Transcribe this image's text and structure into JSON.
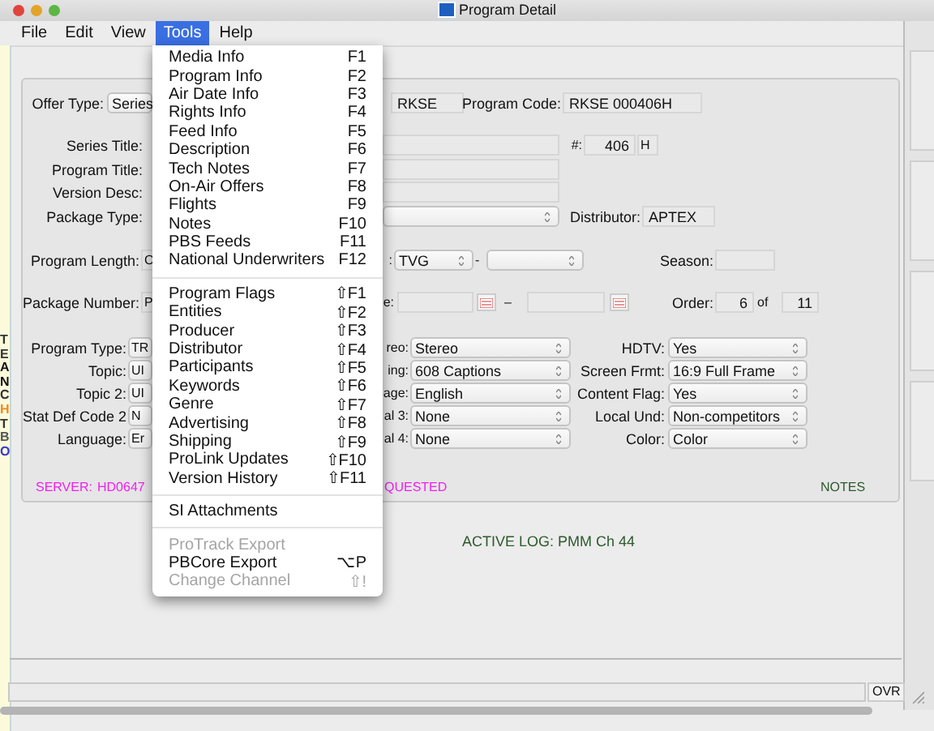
{
  "window": {
    "title": "Program Detail"
  },
  "background_window": {
    "letters": [
      {
        "text": "T",
        "color": "#333333"
      },
      {
        "text": "E",
        "color": "#333333"
      },
      {
        "text": "A",
        "color": "#111111"
      },
      {
        "text": "N",
        "color": "#111111"
      },
      {
        "text": "C",
        "color": "#333333"
      },
      {
        "text": "H",
        "color": "#f08a1c"
      },
      {
        "text": "T",
        "color": "#333333"
      },
      {
        "text": "B",
        "color": "#555555"
      },
      {
        "text": "O",
        "color": "#3a3ad0"
      }
    ]
  },
  "menubar": [
    {
      "label": "File",
      "selected": false
    },
    {
      "label": "Edit",
      "selected": false
    },
    {
      "label": "View",
      "selected": false
    },
    {
      "label": "Tools",
      "selected": true
    },
    {
      "label": "Help",
      "selected": false
    }
  ],
  "tools_menu": {
    "items": [
      {
        "kind": "item",
        "label": "Media Info",
        "shortcut": "F1",
        "disabled": false
      },
      {
        "kind": "item",
        "label": "Program Info",
        "shortcut": "F2",
        "disabled": false
      },
      {
        "kind": "item",
        "label": "Air Date Info",
        "shortcut": "F3",
        "disabled": false
      },
      {
        "kind": "item",
        "label": "Rights Info",
        "shortcut": "F4",
        "disabled": false
      },
      {
        "kind": "item",
        "label": "Feed Info",
        "shortcut": "F5",
        "disabled": false
      },
      {
        "kind": "item",
        "label": "Description",
        "shortcut": "F6",
        "disabled": false
      },
      {
        "kind": "item",
        "label": "Tech Notes",
        "shortcut": "F7",
        "disabled": false
      },
      {
        "kind": "item",
        "label": "On-Air Offers",
        "shortcut": "F8",
        "disabled": false
      },
      {
        "kind": "item",
        "label": "Flights",
        "shortcut": "F9",
        "disabled": false
      },
      {
        "kind": "item",
        "label": "Notes",
        "shortcut": "F10",
        "disabled": false
      },
      {
        "kind": "item",
        "label": "PBS Feeds",
        "shortcut": "F11",
        "disabled": false
      },
      {
        "kind": "item",
        "label": "National Underwriters",
        "shortcut": "F12",
        "disabled": false
      },
      {
        "kind": "separator"
      },
      {
        "kind": "item",
        "label": "Program Flags",
        "shortcut": "⇧F1",
        "disabled": false
      },
      {
        "kind": "item",
        "label": "Entities",
        "shortcut": "⇧F2",
        "disabled": false
      },
      {
        "kind": "item",
        "label": "Producer",
        "shortcut": "⇧F3",
        "disabled": false
      },
      {
        "kind": "item",
        "label": "Distributor",
        "shortcut": "⇧F4",
        "disabled": false
      },
      {
        "kind": "item",
        "label": "Participants",
        "shortcut": "⇧F5",
        "disabled": false
      },
      {
        "kind": "item",
        "label": "Keywords",
        "shortcut": "⇧F6",
        "disabled": false
      },
      {
        "kind": "item",
        "label": "Genre",
        "shortcut": "⇧F7",
        "disabled": false
      },
      {
        "kind": "item",
        "label": "Advertising",
        "shortcut": "⇧F8",
        "disabled": false
      },
      {
        "kind": "item",
        "label": "Shipping",
        "shortcut": "⇧F9",
        "disabled": false
      },
      {
        "kind": "item",
        "label": "ProLink Updates",
        "shortcut": "⇧F10",
        "disabled": false
      },
      {
        "kind": "item",
        "label": "Version History",
        "shortcut": "⇧F11",
        "disabled": false
      },
      {
        "kind": "separator"
      },
      {
        "kind": "item",
        "label": "SI Attachments",
        "disabled": false
      },
      {
        "kind": "separator"
      },
      {
        "kind": "item",
        "label": "ProTrack Export",
        "disabled": true
      },
      {
        "kind": "item",
        "label": "PBCore Export",
        "shortcut": "⌥P",
        "disabled": false
      },
      {
        "kind": "item",
        "label": "Change Channel",
        "shortcut": "⇧!",
        "disabled": true
      }
    ]
  },
  "form": {
    "rows": [
      {
        "items": [
          {
            "kind": "label",
            "text": "Offer Type:"
          },
          {
            "kind": "select",
            "value": "Series"
          },
          {
            "kind": "field",
            "value": "RKSE"
          },
          {
            "kind": "label",
            "text": "Program Code:"
          },
          {
            "kind": "field",
            "value": "RKSE  000406H"
          }
        ]
      },
      {
        "items": [
          {
            "kind": "label",
            "text": "Series Title:"
          },
          {
            "kind": "field"
          },
          {
            "kind": "label",
            "text": "#:"
          },
          {
            "kind": "field",
            "value": "406"
          },
          {
            "kind": "field",
            "value": "H"
          }
        ]
      },
      {
        "items": [
          {
            "kind": "label",
            "text": "Program Title:"
          },
          {
            "kind": "field"
          }
        ]
      },
      {
        "items": [
          {
            "kind": "label",
            "text": "Version Desc:"
          },
          {
            "kind": "field"
          }
        ]
      },
      {
        "items": [
          {
            "kind": "label",
            "text": "Package Type:"
          },
          {
            "kind": "select"
          },
          {
            "kind": "label",
            "text": "Distributor:"
          },
          {
            "kind": "field",
            "value": "APTEX"
          }
        ]
      },
      {
        "items": [
          {
            "kind": "label",
            "text": "Program Length:"
          },
          {
            "kind": "field",
            "value": "C"
          },
          {
            "kind": "label",
            "text": ":"
          },
          {
            "kind": "select",
            "value": "TVG"
          },
          {
            "kind": "label",
            "text": "-"
          },
          {
            "kind": "select"
          },
          {
            "kind": "label",
            "text": "Season:"
          },
          {
            "kind": "field"
          }
        ]
      },
      {
        "items": [
          {
            "kind": "label",
            "text": "Package Number:"
          },
          {
            "kind": "field",
            "value": "P"
          },
          {
            "kind": "label",
            "text": "e:"
          },
          {
            "kind": "field"
          },
          {
            "kind": "calendar"
          },
          {
            "kind": "label",
            "text": "–"
          },
          {
            "kind": "field"
          },
          {
            "kind": "calendar"
          },
          {
            "kind": "label",
            "text": "Order:"
          },
          {
            "kind": "field",
            "value": "6"
          },
          {
            "kind": "label",
            "text": "of"
          },
          {
            "kind": "field",
            "value": "11"
          }
        ]
      },
      {
        "items": [
          {
            "kind": "label",
            "text": "Program Type:"
          },
          {
            "kind": "select",
            "value": "TR"
          },
          {
            "kind": "label",
            "text": "reo:"
          },
          {
            "kind": "select",
            "value": "Stereo"
          },
          {
            "kind": "label",
            "text": "HDTV:"
          },
          {
            "kind": "select",
            "value": "Yes"
          }
        ]
      },
      {
        "items": [
          {
            "kind": "label",
            "text": "Topic:"
          },
          {
            "kind": "select",
            "value": "UI"
          },
          {
            "kind": "label",
            "text": "ing:"
          },
          {
            "kind": "select",
            "value": "608 Captions"
          },
          {
            "kind": "label",
            "text": "Screen Frmt:"
          },
          {
            "kind": "select",
            "value": "16:9 Full Frame"
          }
        ]
      },
      {
        "items": [
          {
            "kind": "label",
            "text": "Topic 2:"
          },
          {
            "kind": "select",
            "value": "UI"
          },
          {
            "kind": "label",
            "text": "age:"
          },
          {
            "kind": "select",
            "value": "English"
          },
          {
            "kind": "label",
            "text": "Content Flag:"
          },
          {
            "kind": "select",
            "value": "Yes"
          }
        ]
      },
      {
        "items": [
          {
            "kind": "label",
            "text": "Stat Def Code 2"
          },
          {
            "kind": "select",
            "value": "N"
          },
          {
            "kind": "label",
            "text": "al 3:"
          },
          {
            "kind": "select",
            "value": "None"
          },
          {
            "kind": "label",
            "text": "Local Und:"
          },
          {
            "kind": "select",
            "value": "Non-competitors"
          }
        ]
      },
      {
        "items": [
          {
            "kind": "label",
            "text": "Language:"
          },
          {
            "kind": "select",
            "value": "Er"
          },
          {
            "kind": "label",
            "text": "al 4:"
          },
          {
            "kind": "select",
            "value": "None"
          },
          {
            "kind": "label",
            "text": "Color:"
          },
          {
            "kind": "select",
            "value": "Color"
          }
        ]
      }
    ],
    "messages": [
      {
        "kind": "alert",
        "text": "SERVER:"
      },
      {
        "kind": "alert",
        "text": "HD0647"
      },
      {
        "kind": "alert",
        "text": "QUESTED"
      },
      {
        "kind": "note",
        "text": "NOTES"
      }
    ]
  },
  "active_log": "ACTIVE LOG: PMM Ch 44",
  "status_bar": {
    "mode": "OVR"
  }
}
